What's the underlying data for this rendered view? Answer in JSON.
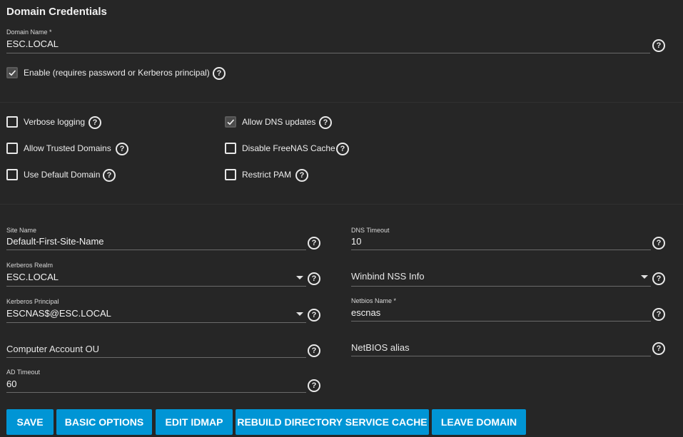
{
  "section": {
    "title": "Domain Credentials"
  },
  "domain_name": {
    "label": "Domain Name *",
    "value": "ESC.LOCAL"
  },
  "enable": {
    "label": "Enable (requires password or Kerberos principal)",
    "checked": true
  },
  "checkboxes": {
    "verbose_logging": {
      "label": "Verbose logging",
      "checked": false
    },
    "allow_trusted_domains": {
      "label": "Allow Trusted Domains",
      "checked": false
    },
    "use_default_domain": {
      "label": "Use Default Domain",
      "checked": false
    },
    "allow_dns_updates": {
      "label": "Allow DNS updates",
      "checked": true
    },
    "disable_freenas_cache": {
      "label": "Disable FreeNAS Cache",
      "checked": false
    },
    "restrict_pam": {
      "label": "Restrict PAM",
      "checked": false
    }
  },
  "fields": {
    "site_name": {
      "label": "Site Name",
      "value": "Default-First-Site-Name"
    },
    "kerberos_realm": {
      "label": "Kerberos Realm",
      "value": "ESC.LOCAL"
    },
    "kerberos_principal": {
      "label": "Kerberos Principal",
      "value": "ESCNAS$@ESC.LOCAL"
    },
    "computer_account_ou": {
      "placeholder": "Computer Account OU"
    },
    "ad_timeout": {
      "label": "AD Timeout",
      "value": "60"
    },
    "dns_timeout": {
      "label": "DNS Timeout",
      "value": "10"
    },
    "winbind_nss_info": {
      "placeholder": "Winbind NSS Info"
    },
    "netbios_name": {
      "label": "Netbios Name *",
      "value": "escnas"
    },
    "netbios_alias": {
      "placeholder": "NetBIOS alias"
    }
  },
  "buttons": {
    "save": "SAVE",
    "basic_options": "BASIC OPTIONS",
    "edit_idmap": "EDIT IDMAP",
    "rebuild_cache": "REBUILD DIRECTORY SERVICE CACHE",
    "leave_domain": "LEAVE DOMAIN"
  },
  "icons": {
    "help": "help-circle-icon",
    "check": "check-icon",
    "dropdown": "caret-down-icon"
  },
  "colors": {
    "background": "#262626",
    "accent": "#0095d5"
  }
}
